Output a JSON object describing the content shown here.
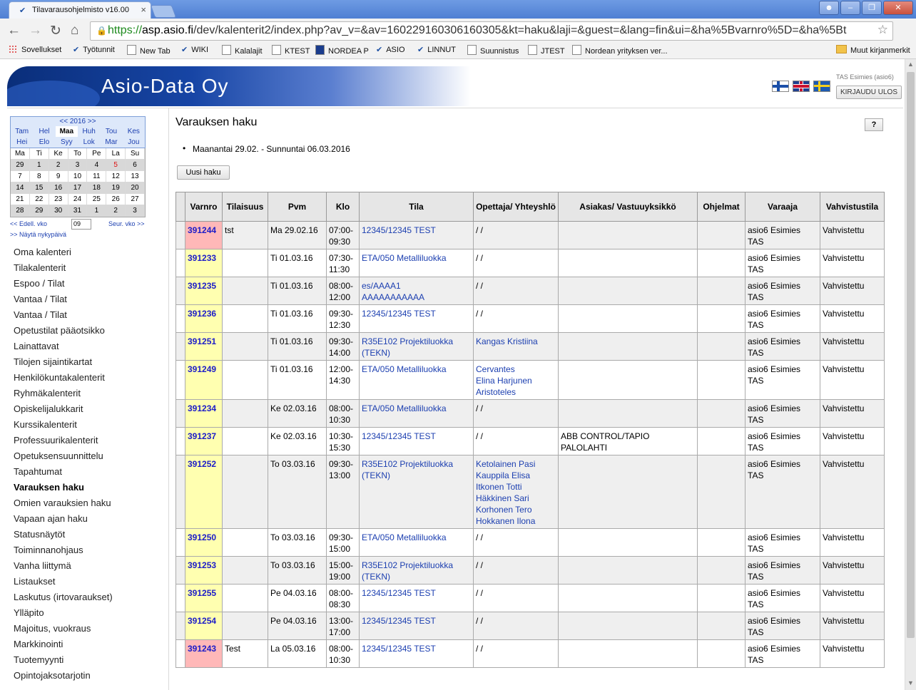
{
  "browser": {
    "tab_title": "Tilavarausohjelmisto v16.00",
    "tab_close": "×",
    "url_prefix": "https://",
    "url_host": "asp.asio.fi",
    "url_path": "/dev/kalenterit2/index.php?av_v=&av=160229160306160305&kt=haku&laji=&guest=&lang=fin&ui=&ha%5Bvarnro%5D=&ha%5Bt",
    "bookmarks": [
      "Sovellukset",
      "Työtunnit",
      "New Tab",
      "WIKI",
      "Kalalajit",
      "KTEST",
      "NORDEA P",
      "ASIO",
      "LINNUT",
      "Suunnistus",
      "JTEST",
      "Nordean yrityksen ver..."
    ],
    "other_bookmarks": "Muut kirjanmerkit"
  },
  "header": {
    "company": "Asio-Data Oy",
    "user": "TAS Esimies (asio6)",
    "logout": "KIRJAUDU ULOS"
  },
  "calendar": {
    "year_label": "<< 2016 >>",
    "months_row1": [
      "Tam",
      "Hel",
      "Maa",
      "Huh",
      "Tou",
      "Kes"
    ],
    "months_row2": [
      "Hei",
      "Elo",
      "Syy",
      "Lok",
      "Mar",
      "Jou"
    ],
    "current_month": "Maa",
    "weekdays": [
      "Ma",
      "Ti",
      "Ke",
      "To",
      "Pe",
      "La",
      "Su"
    ],
    "weeks": [
      [
        "29",
        "1",
        "2",
        "3",
        "4",
        "5",
        "6"
      ],
      [
        "7",
        "8",
        "9",
        "10",
        "11",
        "12",
        "13"
      ],
      [
        "14",
        "15",
        "16",
        "17",
        "18",
        "19",
        "20"
      ],
      [
        "21",
        "22",
        "23",
        "24",
        "25",
        "26",
        "27"
      ],
      [
        "28",
        "29",
        "30",
        "31",
        "1",
        "2",
        "3"
      ]
    ],
    "prev_week": "<< Edell. vko",
    "week_value": "09",
    "next_week": "Seur. vko >>",
    "show_today": ">> Näytä nykypäivä"
  },
  "menu": [
    "Oma kalenteri",
    "Tilakalenterit",
    "Espoo / Tilat",
    "Vantaa / Tilat",
    "Vantaa / Tilat",
    "Opetustilat pääotsikko",
    "Lainattavat",
    "Tilojen sijaintikartat",
    "Henkilökuntakalenterit",
    "Ryhmäkalenterit",
    "Opiskelijalukkarit",
    "Kurssikalenterit",
    "Professuurikalenterit",
    "Opetuksensuunnittelu",
    "Tapahtumat",
    "Varauksen haku",
    "Omien varauksien haku",
    "Vapaan ajan haku",
    "Statusnäytöt",
    "Toiminnanohjaus",
    "Vanha liittymä",
    "Listaukset",
    "Laskutus (irtovaraukset)",
    "Ylläpito",
    "Majoitus, vuokraus",
    "Markkinointi",
    "Tuotemyynti",
    "Opintojaksotarjotin"
  ],
  "menu_active": "Varauksen haku",
  "main": {
    "title": "Varauksen haku",
    "help": "?",
    "date_range": "Maanantai 29.02. - Sunnuntai 06.03.2016",
    "new_search": "Uusi haku",
    "columns": [
      "Varnro",
      "Tilaisuus",
      "Pvm",
      "Klo",
      "Tila",
      "Opettaja/ Yhteyshlö",
      "Asiakas/ Vastuuyksikkö",
      "Ohjelmat",
      "Varaaja",
      "Vahvistustila"
    ],
    "rows": [
      {
        "varnro": "391244",
        "color": "p",
        "tilaisuus": "tst",
        "pvm": "Ma 29.02.16",
        "klo": [
          "07:00-",
          "09:30"
        ],
        "tila": [
          "12345/12345 TEST"
        ],
        "opettaja": [
          "/ /"
        ],
        "asiakas": [],
        "varaaja": [
          "asio6 Esimies",
          "TAS"
        ],
        "tila_status": "Vahvistettu"
      },
      {
        "varnro": "391233",
        "color": "y",
        "tilaisuus": "",
        "pvm": "Ti 01.03.16",
        "klo": [
          "07:30-",
          "11:30"
        ],
        "tila": [
          "ETA/050 Metalliluokka"
        ],
        "opettaja": [
          "/ /"
        ],
        "asiakas": [],
        "varaaja": [
          "asio6 Esimies",
          "TAS"
        ],
        "tila_status": "Vahvistettu"
      },
      {
        "varnro": "391235",
        "color": "y",
        "tilaisuus": "",
        "pvm": "Ti 01.03.16",
        "klo": [
          "08:00-",
          "12:00"
        ],
        "tila": [
          "es/AAAA1",
          "AAAAAAAAAAA"
        ],
        "opettaja": [
          "/ /"
        ],
        "asiakas": [],
        "varaaja": [
          "asio6 Esimies",
          "TAS"
        ],
        "tila_status": "Vahvistettu"
      },
      {
        "varnro": "391236",
        "color": "y",
        "tilaisuus": "",
        "pvm": "Ti 01.03.16",
        "klo": [
          "09:30-",
          "12:30"
        ],
        "tila": [
          "12345/12345 TEST"
        ],
        "opettaja": [
          "/ /"
        ],
        "asiakas": [],
        "varaaja": [
          "asio6 Esimies",
          "TAS"
        ],
        "tila_status": "Vahvistettu"
      },
      {
        "varnro": "391251",
        "color": "y",
        "tilaisuus": "",
        "pvm": "Ti 01.03.16",
        "klo": [
          "09:30-",
          "14:00"
        ],
        "tila": [
          "R35E102 Projektiluokka",
          "(TEKN)"
        ],
        "opettaja": [
          "Kangas Kristiina"
        ],
        "asiakas": [],
        "varaaja": [
          "asio6 Esimies",
          "TAS"
        ],
        "tila_status": "Vahvistettu"
      },
      {
        "varnro": "391249",
        "color": "y",
        "tilaisuus": "",
        "pvm": "Ti 01.03.16",
        "klo": [
          "12:00-",
          "14:30"
        ],
        "tila": [
          "ETA/050 Metalliluokka"
        ],
        "opettaja": [
          "Cervantes",
          "Elina Harjunen",
          "Aristoteles"
        ],
        "asiakas": [],
        "varaaja": [
          "asio6 Esimies",
          "TAS"
        ],
        "tila_status": "Vahvistettu"
      },
      {
        "varnro": "391234",
        "color": "y",
        "tilaisuus": "",
        "pvm": "Ke 02.03.16",
        "klo": [
          "08:00-",
          "10:30"
        ],
        "tila": [
          "ETA/050 Metalliluokka"
        ],
        "opettaja": [
          "/ /"
        ],
        "asiakas": [],
        "varaaja": [
          "asio6 Esimies",
          "TAS"
        ],
        "tila_status": "Vahvistettu"
      },
      {
        "varnro": "391237",
        "color": "y",
        "tilaisuus": "",
        "pvm": "Ke 02.03.16",
        "klo": [
          "10:30-",
          "15:30"
        ],
        "tila": [
          "12345/12345 TEST"
        ],
        "opettaja": [
          "/ /"
        ],
        "asiakas": [
          "ABB CONTROL/TAPIO",
          "PALOLAHTI"
        ],
        "varaaja": [
          "asio6 Esimies",
          "TAS"
        ],
        "tila_status": "Vahvistettu"
      },
      {
        "varnro": "391252",
        "color": "y",
        "tilaisuus": "",
        "pvm": "To 03.03.16",
        "klo": [
          "09:30-",
          "13:00"
        ],
        "tila": [
          "R35E102 Projektiluokka",
          "(TEKN)"
        ],
        "opettaja": [
          "Ketolainen Pasi",
          "Kauppila Elisa",
          "Itkonen Totti",
          "Häkkinen Sari",
          "Korhonen Tero",
          "Hokkanen Ilona"
        ],
        "asiakas": [],
        "varaaja": [
          "asio6 Esimies",
          "TAS"
        ],
        "tila_status": "Vahvistettu"
      },
      {
        "varnro": "391250",
        "color": "y",
        "tilaisuus": "",
        "pvm": "To 03.03.16",
        "klo": [
          "09:30-",
          "15:00"
        ],
        "tila": [
          "ETA/050 Metalliluokka"
        ],
        "opettaja": [
          "/ /"
        ],
        "asiakas": [],
        "varaaja": [
          "asio6 Esimies",
          "TAS"
        ],
        "tila_status": "Vahvistettu"
      },
      {
        "varnro": "391253",
        "color": "y",
        "tilaisuus": "",
        "pvm": "To 03.03.16",
        "klo": [
          "15:00-",
          "19:00"
        ],
        "tila": [
          "R35E102 Projektiluokka",
          "(TEKN)"
        ],
        "opettaja": [
          "/ /"
        ],
        "asiakas": [],
        "varaaja": [
          "asio6 Esimies",
          "TAS"
        ],
        "tila_status": "Vahvistettu"
      },
      {
        "varnro": "391255",
        "color": "y",
        "tilaisuus": "",
        "pvm": "Pe 04.03.16",
        "klo": [
          "08:00-",
          "08:30"
        ],
        "tila": [
          "12345/12345 TEST"
        ],
        "opettaja": [
          "/ /"
        ],
        "asiakas": [],
        "varaaja": [
          "asio6 Esimies",
          "TAS"
        ],
        "tila_status": "Vahvistettu"
      },
      {
        "varnro": "391254",
        "color": "y",
        "tilaisuus": "",
        "pvm": "Pe 04.03.16",
        "klo": [
          "13:00-",
          "17:00"
        ],
        "tila": [
          "12345/12345 TEST"
        ],
        "opettaja": [
          "/ /"
        ],
        "asiakas": [],
        "varaaja": [
          "asio6 Esimies",
          "TAS"
        ],
        "tila_status": "Vahvistettu"
      },
      {
        "varnro": "391243",
        "color": "p",
        "tilaisuus": "Test",
        "pvm": "La 05.03.16",
        "klo": [
          "08:00-",
          "10:30"
        ],
        "tila": [
          "12345/12345 TEST"
        ],
        "opettaja": [
          "/ /"
        ],
        "asiakas": [],
        "varaaja": [
          "asio6 Esimies",
          "TAS"
        ],
        "tila_status": "Vahvistettu"
      }
    ]
  }
}
